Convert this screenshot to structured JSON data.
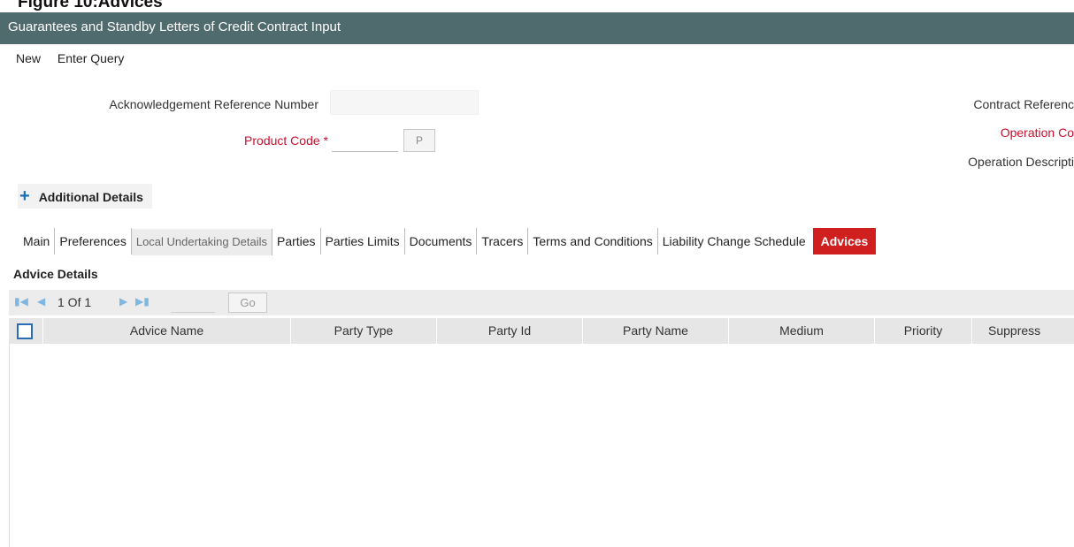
{
  "figure_caption": "Figure 10:Advices",
  "window": {
    "title": "Guarantees and Standby Letters of Credit Contract Input"
  },
  "menu": {
    "items": [
      "New",
      "Enter Query"
    ]
  },
  "form": {
    "ack_ref_label": "Acknowledgement Reference Number",
    "ack_ref_value": "",
    "product_code_label": "Product Code",
    "product_code_required": "*",
    "product_code_value": "",
    "lov_label": "P",
    "contract_ref_label": "Contract Referenc",
    "operation_code_label": "Operation Co",
    "operation_desc_label": "Operation Descripti"
  },
  "additional_details": {
    "icon": "plus-icon",
    "label": "Additional Details"
  },
  "tabs": [
    "Main",
    "Preferences",
    "Local Undertaking Details",
    "Parties",
    "Parties Limits",
    "Documents",
    "Tracers",
    "Terms and Conditions",
    "Liability Change Schedule",
    "Advices"
  ],
  "active_tab": "Advices",
  "advice_section": {
    "title": "Advice Details",
    "pager": {
      "text": "1 Of 1",
      "go_label": "Go",
      "page_input": ""
    },
    "columns": [
      "Advice Name",
      "Party Type",
      "Party Id",
      "Party Name",
      "Medium",
      "Priority",
      "Suppress"
    ],
    "rows": []
  },
  "colors": {
    "titlebar": "#4f6b6d",
    "active_tab": "#d01f1f",
    "required": "#c8102e",
    "pager_icon": "#7fb7e3"
  }
}
